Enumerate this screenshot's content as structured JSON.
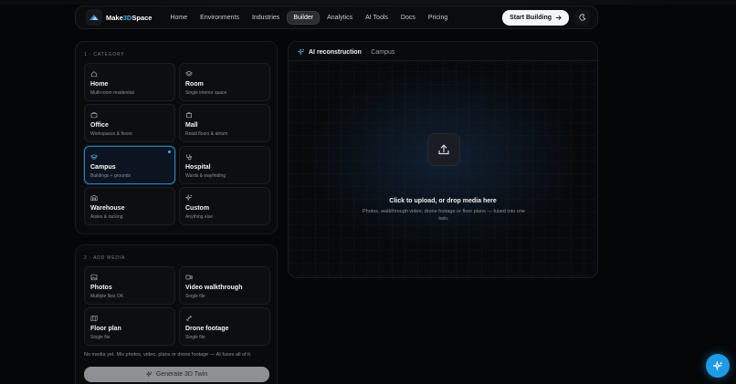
{
  "nav": {
    "brand_prefix": "Make",
    "brand_accent": "3D",
    "brand_suffix": "Space",
    "links": [
      "Home",
      "Environments",
      "Industries",
      "Builder",
      "Analytics",
      "AI Tools",
      "Docs",
      "Pricing"
    ],
    "active_link": "Builder",
    "start_button": "Start Building",
    "theme_icon": "moon-icon"
  },
  "category": {
    "label": "1 · CATEGORY",
    "selected": "Campus",
    "items": [
      {
        "title": "Home",
        "sub": "Multi-room residential",
        "icon": "house-icon"
      },
      {
        "title": "Room",
        "sub": "Single interior space",
        "icon": "layers-icon"
      },
      {
        "title": "Office",
        "sub": "Workspaces & floors",
        "icon": "briefcase-icon"
      },
      {
        "title": "Mall",
        "sub": "Retail floors & atrium",
        "icon": "shopping-bag-icon"
      },
      {
        "title": "Campus",
        "sub": "Buildings + grounds",
        "icon": "graduation-cap-icon"
      },
      {
        "title": "Hospital",
        "sub": "Wards & wayfinding",
        "icon": "stethoscope-icon"
      },
      {
        "title": "Warehouse",
        "sub": "Aisles & racking",
        "icon": "warehouse-icon"
      },
      {
        "title": "Custom",
        "sub": "Anything else",
        "icon": "sparkles-icon"
      }
    ]
  },
  "media": {
    "label": "2 · ADD MEDIA",
    "items": [
      {
        "title": "Photos",
        "sub": "Multiple files OK",
        "icon": "image-icon"
      },
      {
        "title": "Video walkthrough",
        "sub": "Single file",
        "icon": "video-icon"
      },
      {
        "title": "Floor plan",
        "sub": "Single file",
        "icon": "map-icon"
      },
      {
        "title": "Drone footage",
        "sub": "Single file",
        "icon": "drone-icon"
      }
    ],
    "note": "No media yet. Mix photos, video, plans or drone footage — AI fuses all of it.",
    "generate_button": "Generate 3D Twin"
  },
  "reconstruction": {
    "title": "AI reconstruction",
    "separator": "·",
    "subtitle": "Campus",
    "upload_title": "Click to upload, or drop media here",
    "upload_desc": "Photos, walkthrough video, drone footage or floor plans — fused into one twin."
  },
  "colors": {
    "accent": "#1e9be6",
    "selected_border": "#2d7fb8",
    "background": "#050608"
  },
  "fab_icon": "sparkles-icon"
}
